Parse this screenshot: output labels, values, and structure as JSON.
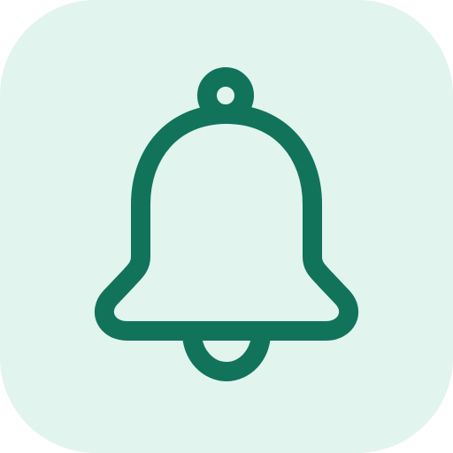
{
  "icon": {
    "name": "bell-icon",
    "tile_color": "#e1f4ee",
    "stroke_color": "#11735a"
  }
}
